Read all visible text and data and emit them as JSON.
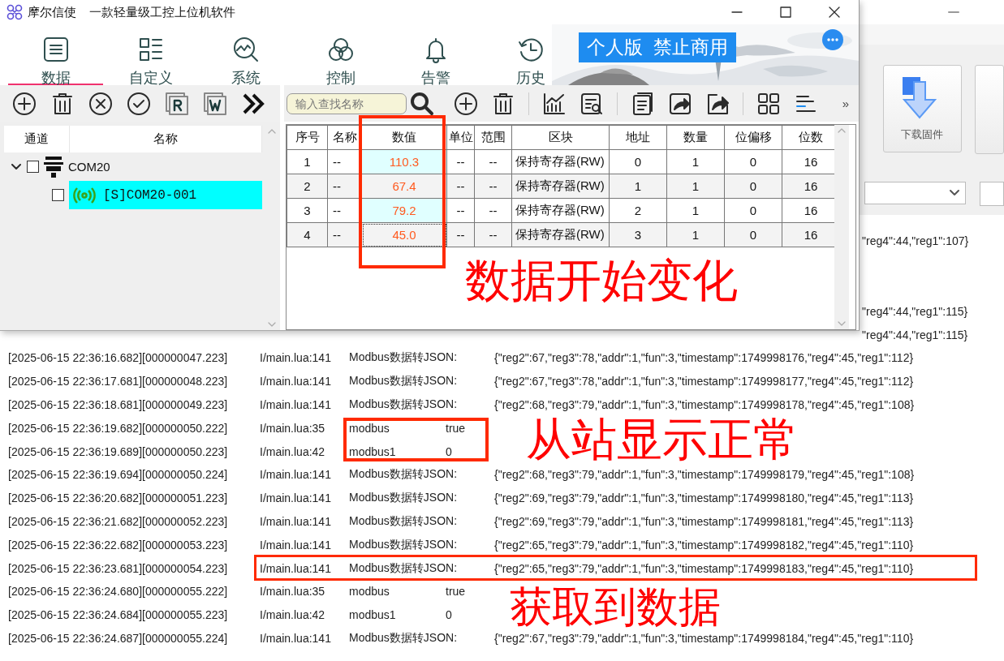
{
  "app": {
    "title": "摩尔信使",
    "subtitle": "一款轻量级工控上位机软件",
    "badge": "个人版  禁止商用"
  },
  "nav": [
    {
      "label": "数据",
      "selected": true
    },
    {
      "label": "自定义",
      "selected": false
    },
    {
      "label": "系统",
      "selected": false
    },
    {
      "label": "控制",
      "selected": false
    },
    {
      "label": "告警",
      "selected": false
    },
    {
      "label": "历史",
      "selected": false
    }
  ],
  "search": {
    "placeholder": "输入查找名称"
  },
  "toolbar_more": "»",
  "tree": {
    "columns": [
      "通道",
      "名称"
    ],
    "items": [
      {
        "label": "COM20",
        "checked": false,
        "expanded": true,
        "children": [
          {
            "label": "[S]COM20-001",
            "checked": false,
            "selected": true
          }
        ]
      }
    ]
  },
  "table": {
    "columns": [
      "序号",
      "名称",
      "数值",
      "单位",
      "范围",
      "区块",
      "地址",
      "数量",
      "位偏移",
      "位数"
    ],
    "rows": [
      {
        "cells": [
          "1",
          "--",
          "110.3",
          "--",
          "--",
          "保持寄存器(RW)",
          "0",
          "1",
          "0",
          "16"
        ],
        "focused": false
      },
      {
        "cells": [
          "2",
          "--",
          "67.4",
          "--",
          "--",
          "保持寄存器(RW)",
          "1",
          "1",
          "0",
          "16"
        ],
        "focused": false
      },
      {
        "cells": [
          "3",
          "--",
          "79.2",
          "--",
          "--",
          "保持寄存器(RW)",
          "2",
          "1",
          "0",
          "16"
        ],
        "focused": false
      },
      {
        "cells": [
          "4",
          "--",
          "45.0",
          "--",
          "--",
          "保持寄存器(RW)",
          "3",
          "1",
          "0",
          "16"
        ],
        "focused": true
      }
    ]
  },
  "background_window": {
    "button": "下载固件",
    "log_fragments": [
      "\"reg4\":44,\"reg1\":107}",
      "\"reg4\":44,\"reg1\":115}",
      "\"reg4\":44,\"reg1\":115}"
    ],
    "log": [
      {
        "kind": "json",
        "time": "[2025-06-15 22:36:16.682][000000047.223]",
        "source": "I/main.lua:141",
        "message": "Modbus数据转JSON:",
        "json": "{\"reg2\":67,\"reg3\":78,\"addr\":1,\"fun\":3,\"timestamp\":1749998176,\"reg4\":45,\"reg1\":112}"
      },
      {
        "kind": "json",
        "time": "[2025-06-15 22:36:17.681][000000048.223]",
        "source": "I/main.lua:141",
        "message": "Modbus数据转JSON:",
        "json": "{\"reg2\":67,\"reg3\":78,\"addr\":1,\"fun\":3,\"timestamp\":1749998177,\"reg4\":45,\"reg1\":112}"
      },
      {
        "kind": "json",
        "time": "[2025-06-15 22:36:18.681][000000049.223]",
        "source": "I/main.lua:141",
        "message": "Modbus数据转JSON:",
        "json": "{\"reg2\":68,\"reg3\":79,\"addr\":1,\"fun\":3,\"timestamp\":1749998178,\"reg4\":45,\"reg1\":108}"
      },
      {
        "kind": "value",
        "time": "[2025-06-15 22:36:19.682][000000050.222]",
        "source": "I/main.lua:35",
        "message": "modbus",
        "value": "true"
      },
      {
        "kind": "value",
        "time": "[2025-06-15 22:36:19.689][000000050.223]",
        "source": "I/main.lua:42",
        "message": "modbus1",
        "value": "0"
      },
      {
        "kind": "json",
        "time": "[2025-06-15 22:36:19.694][000000050.224]",
        "source": "I/main.lua:141",
        "message": "Modbus数据转JSON:",
        "json": "{\"reg2\":68,\"reg3\":79,\"addr\":1,\"fun\":3,\"timestamp\":1749998179,\"reg4\":45,\"reg1\":108}"
      },
      {
        "kind": "json",
        "time": "[2025-06-15 22:36:20.682][000000051.223]",
        "source": "I/main.lua:141",
        "message": "Modbus数据转JSON:",
        "json": "{\"reg2\":69,\"reg3\":79,\"addr\":1,\"fun\":3,\"timestamp\":1749998180,\"reg4\":45,\"reg1\":113}"
      },
      {
        "kind": "json",
        "time": "[2025-06-15 22:36:21.682][000000052.223]",
        "source": "I/main.lua:141",
        "message": "Modbus数据转JSON:",
        "json": "{\"reg2\":69,\"reg3\":79,\"addr\":1,\"fun\":3,\"timestamp\":1749998181,\"reg4\":45,\"reg1\":113}"
      },
      {
        "kind": "json",
        "time": "[2025-06-15 22:36:22.682][000000053.223]",
        "source": "I/main.lua:141",
        "message": "Modbus数据转JSON:",
        "json": "{\"reg2\":65,\"reg3\":79,\"addr\":1,\"fun\":3,\"timestamp\":1749998182,\"reg4\":45,\"reg1\":110}"
      },
      {
        "kind": "json",
        "time": "[2025-06-15 22:36:23.681][000000054.223]",
        "source": "I/main.lua:141",
        "message": "Modbus数据转JSON:",
        "json": "{\"reg2\":65,\"reg3\":79,\"addr\":1,\"fun\":3,\"timestamp\":1749998183,\"reg4\":45,\"reg1\":110}"
      },
      {
        "kind": "value",
        "time": "[2025-06-15 22:36:24.680][000000055.222]",
        "source": "I/main.lua:35",
        "message": "modbus",
        "value": "true"
      },
      {
        "kind": "value",
        "time": "[2025-06-15 22:36:24.684][000000055.223]",
        "source": "I/main.lua:42",
        "message": "modbus1",
        "value": "0"
      },
      {
        "kind": "json",
        "time": "[2025-06-15 22:36:24.687][000000055.224]",
        "source": "I/main.lua:141",
        "message": "Modbus数据转JSON:",
        "json": "{\"reg2\":67,\"reg3\":79,\"addr\":1,\"fun\":3,\"timestamp\":1749998184,\"reg4\":45,\"reg1\":110}"
      }
    ]
  },
  "annotations": [
    "数据开始变化",
    "从站显示正常",
    "获取到数据"
  ]
}
